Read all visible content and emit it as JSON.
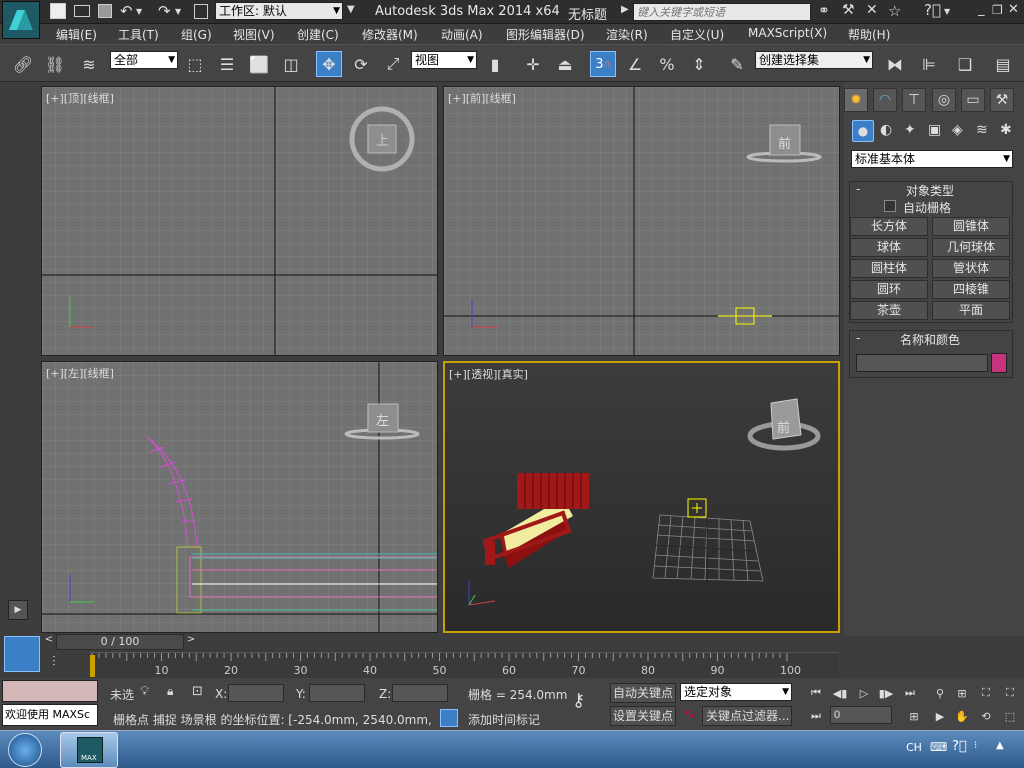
{
  "title": {
    "workspace": "工作区: 默认",
    "app": "Autodesk 3ds Max  2014 x64",
    "doc": "无标题",
    "search_placeholder": "键入关键字或短语"
  },
  "menu": [
    "编辑(E)",
    "工具(T)",
    "组(G)",
    "视图(V)",
    "创建(C)",
    "修改器(M)",
    "动画(A)",
    "图形编辑器(D)",
    "渲染(R)",
    "自定义(U)",
    "MAXScript(X)",
    "帮助(H)"
  ],
  "toolbar": {
    "filter": "全部",
    "refcoord": "视图",
    "snap_value": "3",
    "named_selection": "创建选择集"
  },
  "viewports": {
    "top": {
      "label": "[+][顶][线框]",
      "cube": "上"
    },
    "front": {
      "label": "[+][前][线框]",
      "cube": "前"
    },
    "left": {
      "label": "[+][左][线框]",
      "cube": "左"
    },
    "persp": {
      "label": "[+][透视][真实]",
      "cube": "前"
    }
  },
  "command_panel": {
    "category": "标准基本体",
    "rollout_object_type": "对象类型",
    "autogrid": "自动栅格",
    "buttons": [
      "长方体",
      "圆锥体",
      "球体",
      "几何球体",
      "圆柱体",
      "管状体",
      "圆环",
      "四棱锥",
      "茶壶",
      "平面"
    ],
    "rollout_name_color": "名称和颜色",
    "object_color": "#c8337d"
  },
  "timeline": {
    "frame_counter": "0 / 100",
    "ticks": [
      "10",
      "20",
      "30",
      "40",
      "50",
      "60",
      "70",
      "80",
      "90",
      "100"
    ]
  },
  "status": {
    "welcome": "欢迎使用 MAXSc",
    "selection": "未选",
    "x_label": "X:",
    "y_label": "Y:",
    "z_label": "Z:",
    "grid": "栅格 = 254.0mm",
    "prompt": "栅格点 捕捉 场景根 的坐标位置: [-254.0mm, 2540.0mm, 0.0mm]",
    "add_time_tag": "添加时间标记",
    "auto_key": "自动关键点",
    "set_key": "设置关键点",
    "key_filter_dd": "选定对象",
    "key_filters": "关键点过滤器...",
    "frame": "0"
  },
  "taskbar": {
    "lang": "CH",
    "app_icon": "MAX"
  }
}
